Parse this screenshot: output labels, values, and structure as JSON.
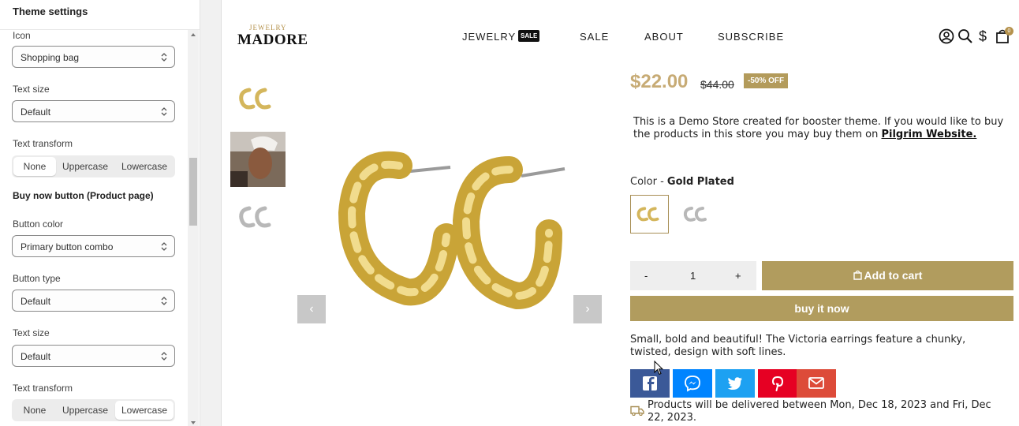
{
  "panel": {
    "title": "Theme settings",
    "fields": {
      "icon_label": "Icon",
      "icon_value": "Shopping bag",
      "text_size_label_1": "Text size",
      "text_size_value_1": "Default",
      "text_transform_label_1": "Text transform",
      "transform_options_1": [
        "None",
        "Uppercase",
        "Lowercase"
      ],
      "transform_selected_1": "None",
      "section_buy_now": "Buy now button (Product page)",
      "button_color_label": "Button color",
      "button_color_value": "Primary button combo",
      "button_type_label": "Button type",
      "button_type_value": "Default",
      "text_size_label_2": "Text size",
      "text_size_value_2": "Default",
      "text_transform_label_2": "Text transform",
      "transform_options_2": [
        "None",
        "Uppercase",
        "Lowercase"
      ],
      "transform_selected_2": "Lowercase"
    }
  },
  "store": {
    "logo_small": "JEWELRY",
    "logo_main": "MADORE",
    "nav": [
      "JEWELRY",
      "SALE",
      "ABOUT",
      "SUBSCRIBE"
    ],
    "nav_badge": "SALE",
    "cart_count": "0",
    "header_icons": [
      "user-icon",
      "search-icon",
      "currency-icon",
      "cart-icon"
    ]
  },
  "product": {
    "price": "$22.00",
    "compare_price": "$44.00",
    "discount": "-50% OFF",
    "description_text": "This is a Demo Store created for booster theme. If you would like to buy the products in this store you may buy them on ",
    "description_link": "Pilgrim Website.",
    "color_label": "Color",
    "color_separator": " - ",
    "color_value": "Gold Plated",
    "qty_minus": "-",
    "qty_value": "1",
    "qty_plus": "+",
    "add_to_cart": "Add to cart",
    "buy_now": "buy it now",
    "blurb": "Small, bold and beautiful! The Victoria earrings feature a chunky, twisted, design with soft lines.",
    "delivery": "Products will be delivered between Mon, Dec 18, 2023 and Fri, Dec 22, 2023.",
    "share_buttons": [
      {
        "name": "facebook",
        "color": "#3b5998"
      },
      {
        "name": "messenger",
        "color": "#0084ff"
      },
      {
        "name": "twitter",
        "color": "#1da1f2"
      },
      {
        "name": "pinterest",
        "color": "#e60023"
      },
      {
        "name": "email",
        "color": "#dd4b39"
      }
    ]
  },
  "colors": {
    "accent": "#b19c5e",
    "price": "#c7ab75",
    "logo_gold": "#b5924c"
  }
}
